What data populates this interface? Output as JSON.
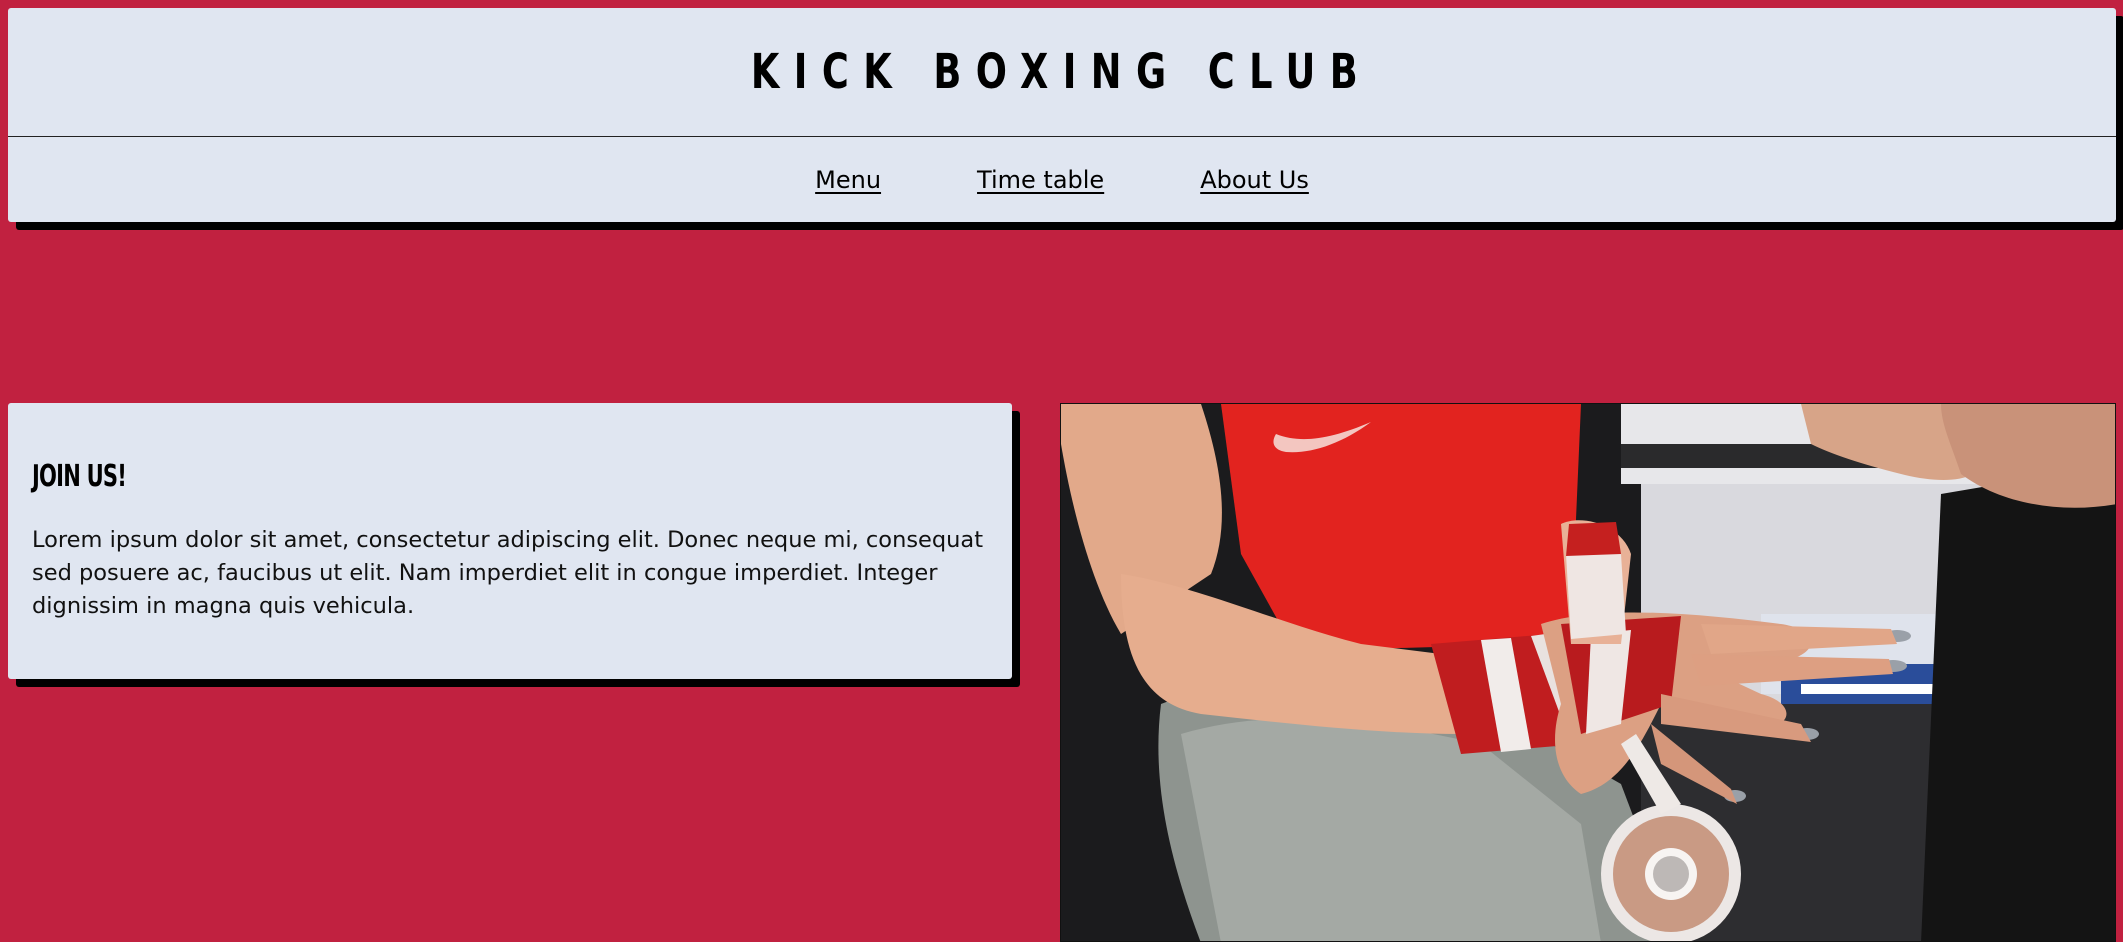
{
  "header": {
    "title": "KICK BOXING CLUB",
    "nav": [
      {
        "label": "Menu"
      },
      {
        "label": "Time table"
      },
      {
        "label": "About Us"
      }
    ]
  },
  "join": {
    "heading": "JOIN US!",
    "body": "Lorem ipsum dolor sit amet, consectetur adipiscing elit. Donec neque mi, consequat sed posuere ac, faucibus ut elit. Nam imperdiet elit in congue imperdiet. Integer dignissim in magna quis vehicula."
  },
  "photo": {
    "icon": "boxer-wrapping-hands-photo"
  },
  "colors": {
    "background": "#c12140",
    "card": "#e0e6f1",
    "shadow": "#000000"
  }
}
